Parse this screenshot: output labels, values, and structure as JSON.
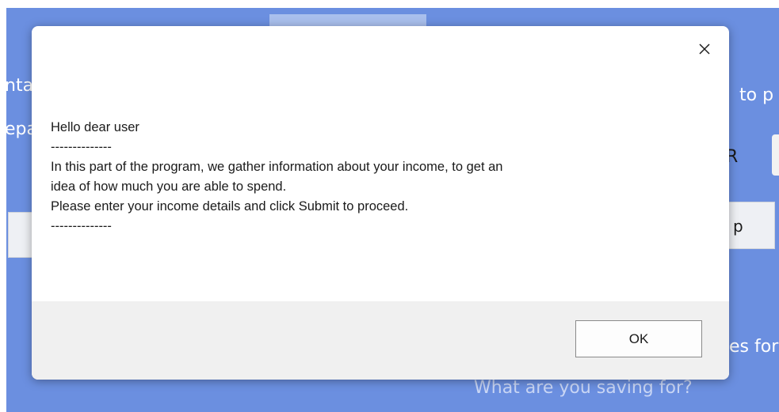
{
  "background": {
    "left_fragments": [
      "nta",
      "epa"
    ],
    "right_fragments": [
      "to p",
      "R",
      "es for"
    ],
    "right_button_label": "p",
    "bottom_prompt": "What are you saving for?"
  },
  "dialog": {
    "message_lines": [
      "Hello dear user",
      "--------------",
      "In this part of the program, we gather information about your income, to get an",
      "idea of how much you are able to spend.",
      "Please enter your income details and click Submit to proceed.",
      "--------------"
    ],
    "ok_label": "OK",
    "close_icon": "close-icon"
  },
  "colors": {
    "app_background": "#6b8fe0",
    "dialog_footer": "#f0f0f0"
  }
}
